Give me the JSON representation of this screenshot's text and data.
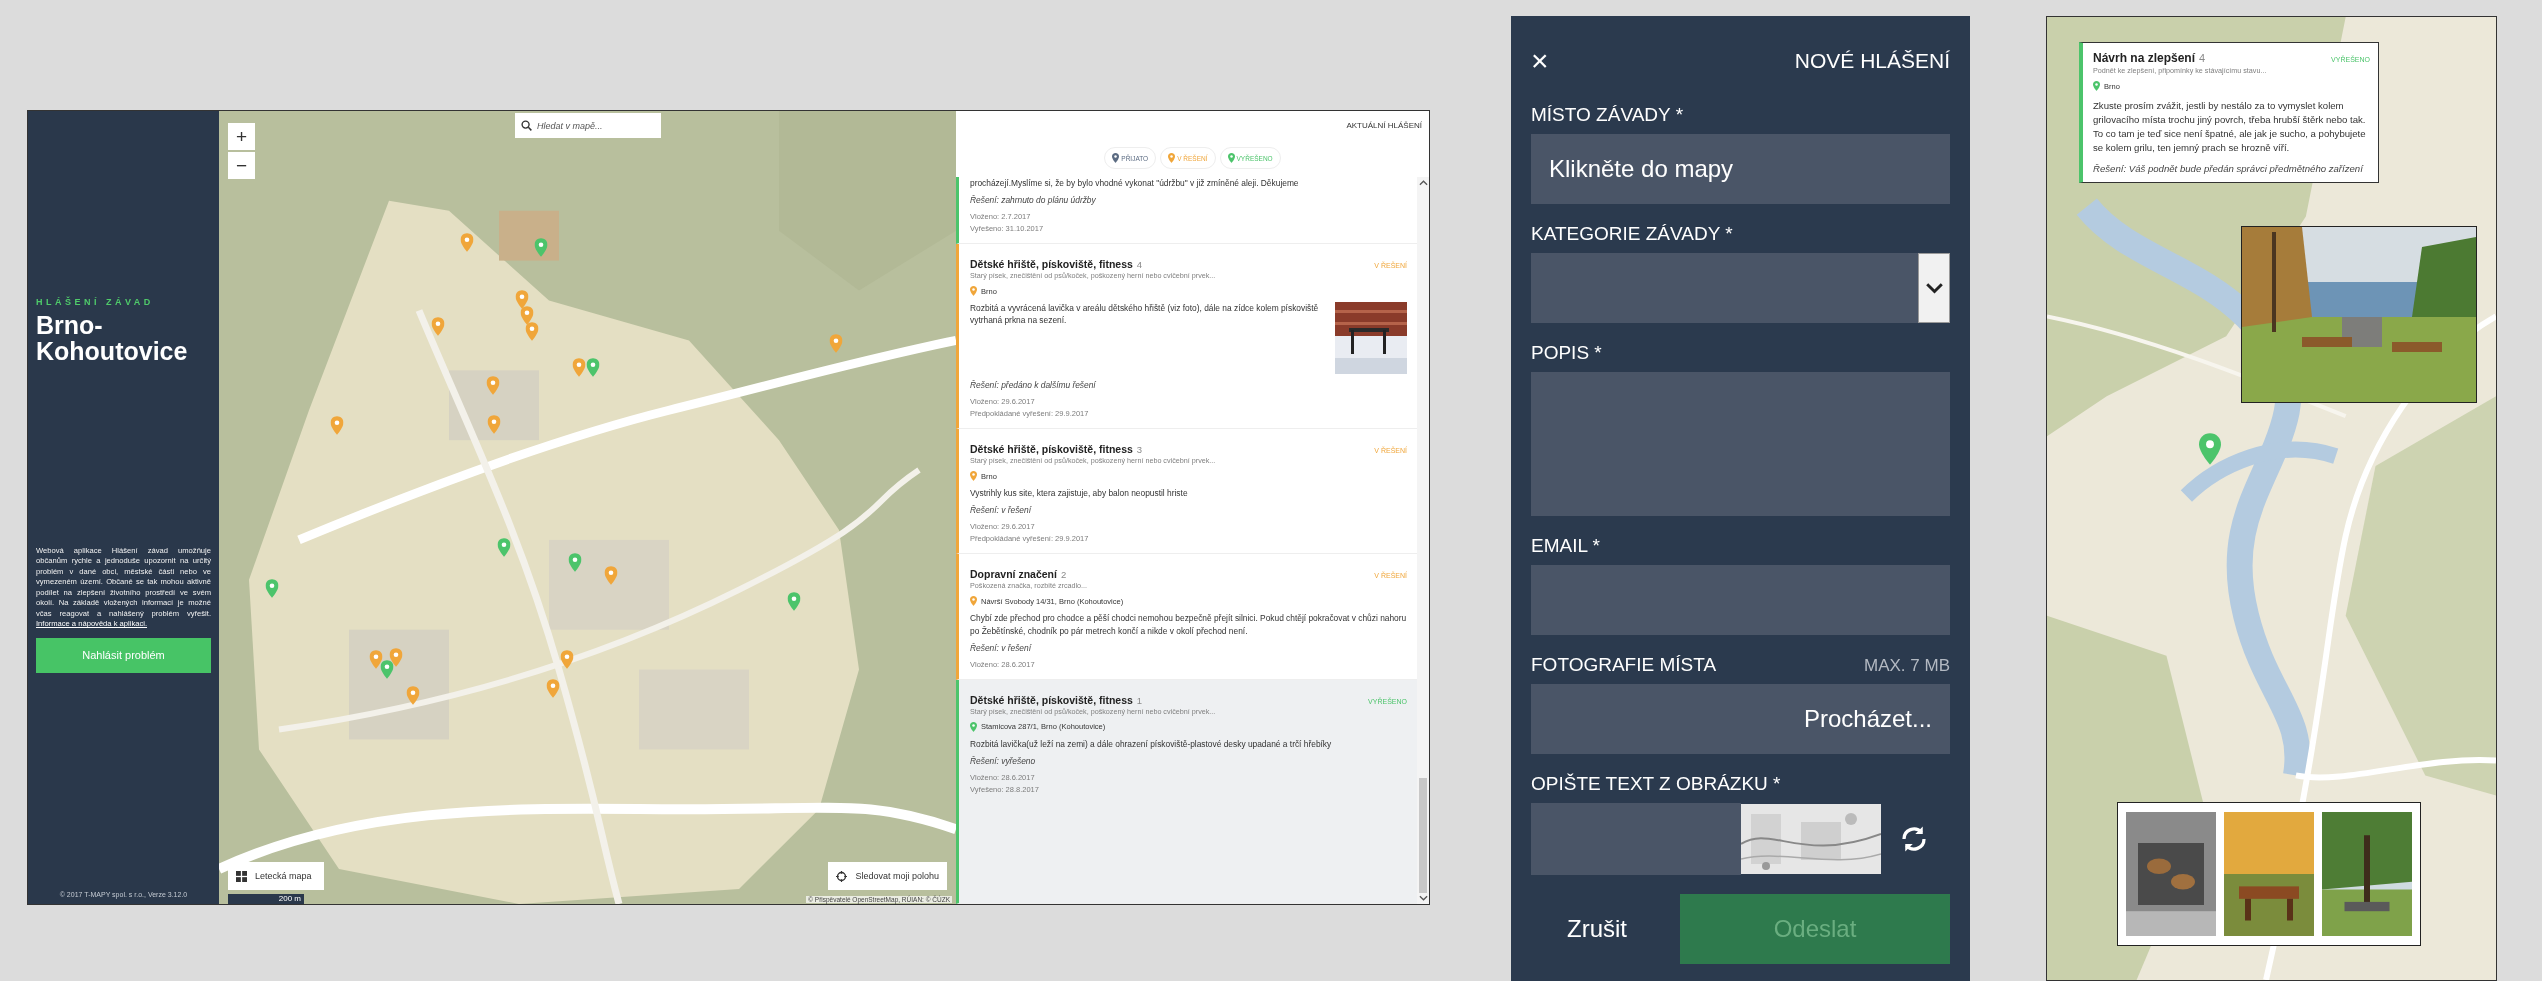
{
  "desktop": {
    "sidebar": {
      "kicker": "HLÁŠENÍ ZÁVAD",
      "title": "Brno-Kohoutovice",
      "about": "Webová aplikace Hlášení závad umožňuje občanům rychle a jednoduše upozornit na určitý problém v dané obci, městské části nebo ve vymezeném území. Občané se tak mohou aktivně podílet na zlepšení životního prostředí ve svém okolí. Na základě vložených informací je možné včas reagovat a nahlášený problém vyřešit.",
      "help_link": "Informace a nápověda k aplikaci.",
      "report_button": "Nahlásit problém",
      "footer": "© 2017 T-MAPY spol. s r.o., Verze 3.12.0"
    },
    "map": {
      "zoom_in": "+",
      "zoom_out": "−",
      "search": {
        "placeholder": "Hledat v mapě..."
      },
      "layer_button": "Letecká mapa",
      "scale": "200 m",
      "locate_button": "Sledovat moji polohu",
      "attribution": "© Přispěvatelé OpenStreetMap, RÚIAN: © ČÚZK",
      "markers": [
        {
          "color": "#f0a63a"
        },
        {
          "color": "#4cc46b"
        },
        {
          "color": "#f0a63a"
        },
        {
          "color": "#f0a63a"
        },
        {
          "color": "#f0a63a"
        },
        {
          "color": "#f0a63a"
        },
        {
          "color": "#f0a63a"
        },
        {
          "color": "#f0a63a"
        },
        {
          "color": "#4cc46b"
        },
        {
          "color": "#f0a63a"
        },
        {
          "color": "#f0a63a"
        },
        {
          "color": "#f0a63a"
        },
        {
          "color": "#f0a63a"
        },
        {
          "color": "#4cc46b"
        },
        {
          "color": "#4cc46b"
        },
        {
          "color": "#4cc46b"
        },
        {
          "color": "#4cc46b"
        },
        {
          "color": "#f0a63a"
        },
        {
          "color": "#f0a63a"
        },
        {
          "color": "#4cc46b"
        },
        {
          "color": "#f0a63a"
        },
        {
          "color": "#f0a63a"
        },
        {
          "color": "#f0a63a"
        }
      ]
    },
    "list": {
      "title": "AKTUÁLNÍ HLÁŠENÍ",
      "filters": [
        {
          "label": "PŘIJATO",
          "color": "#5b6b82"
        },
        {
          "label": "V ŘEŠENÍ",
          "color": "#f0a63a"
        },
        {
          "label": "VYŘEŠENO",
          "color": "#4cc46b"
        }
      ],
      "reports": [
        {
          "color": "#4cc46b",
          "selected": false,
          "description": "procházejí.Myslíme si, že by bylo vhodné vykonat \"údržbu\" v již zmíněné aleji. Děkujeme",
          "solution": "Řešení: zahrnuto do plánu údržby",
          "dates": [
            "Vloženo: 2.7.2017",
            "Vyřešeno: 31.10.2017"
          ]
        },
        {
          "color": "#f0a63a",
          "selected": false,
          "title": "Dětské hřiště, pískoviště, fitness",
          "count": "4",
          "status_label": "V ŘEŠENÍ",
          "subtitle": "Starý písek, znečištění od psů/koček, poškozený herní nebo cvičební prvek...",
          "location": "Brno",
          "description": "Rozbitá a vyvrácená lavička v areálu dětského hřiště (viz foto), dále na zídce kolem pískoviště vytrhaná prkna na sezení.",
          "photo": true,
          "solution": "Řešení: předáno k dalšímu řešení",
          "dates": [
            "Vloženo: 29.6.2017",
            "Předpokládané vyřešení: 29.9.2017"
          ]
        },
        {
          "color": "#f0a63a",
          "selected": false,
          "title": "Dětské hřiště, pískoviště, fitness",
          "count": "3",
          "status_label": "V ŘEŠENÍ",
          "subtitle": "Starý písek, znečištění od psů/koček, poškozený herní nebo cvičební prvek...",
          "location": "Brno",
          "description": "Vystrihly kus site, ktera zajistuje, aby balon neopustil hriste",
          "solution": "Řešení: v řešení",
          "dates": [
            "Vloženo: 29.6.2017",
            "Předpokládané vyřešení: 29.9.2017"
          ]
        },
        {
          "color": "#f0a63a",
          "selected": false,
          "title": "Dopravní značení",
          "count": "2",
          "status_label": "V ŘEŠENÍ",
          "subtitle": "Poškozená značka, rozbité zrcadlo...",
          "location": "Návrší Svobody 14/31, Brno (Kohoutovice)",
          "description": "Chybí zde přechod pro chodce a pěší chodci nemohou bezpečně přejít silnici. Pokud chtějí pokračovat v chůzi nahoru po Žebětínské, chodník po pár metrech končí a nikde v okolí přechod není.",
          "solution": "Řešení: v řešení",
          "dates": [
            "Vloženo: 28.6.2017"
          ]
        },
        {
          "color": "#4cc46b",
          "selected": true,
          "title": "Dětské hřiště, pískoviště, fitness",
          "count": "1",
          "status_label": "VYŘEŠENO",
          "subtitle": "Starý písek, znečištění od psů/koček, poškozený herní nebo cvičební prvek...",
          "location": "Stamicova 287/1, Brno (Kohoutovice)",
          "description": "Rozbitá lavička(už leží na zemi) a dále ohrazení pískoviště-plastové desky upadané a trčí hřebíky",
          "solution": "Řešení: vyřešeno",
          "dates": [
            "Vloženo: 28.6.2017",
            "Vyřešeno: 28.8.2017"
          ]
        }
      ]
    }
  },
  "form": {
    "close": "×",
    "title": "NOVÉ HLÁŠENÍ",
    "fields": [
      {
        "kind": "text",
        "label": "MÍSTO ZÁVADY *",
        "placeholder": "Klikněte do mapy"
      },
      {
        "kind": "select",
        "label": "KATEGORIE ZÁVADY *"
      },
      {
        "kind": "textarea",
        "label": "POPIS *"
      },
      {
        "kind": "text",
        "label": "EMAIL *"
      },
      {
        "kind": "file",
        "label": "FOTOGRAFIE MÍSTA",
        "hint": "MAX. 7 MB",
        "button": "Procházet..."
      },
      {
        "kind": "captcha",
        "label": "OPIŠTE TEXT Z OBRÁZKU *"
      }
    ],
    "cancel": "Zrušit",
    "submit": {
      "label": "Odeslat",
      "disabled": true
    }
  },
  "mobile": {
    "popup": {
      "color": "#4cc46b",
      "title": "Návrh na zlepšení",
      "count": "4",
      "status_label": "VYŘEŠENO",
      "subtitle": "Podnět ke zlepšení, připomínky ke stávajícímu stavu...",
      "location": "Brno",
      "description": "Zkuste prosím zvážit, jestli by nestálo za to vymyslet kolem grilovacího místa trochu jiný povrch, třeba hrubší štěrk nebo tak. To co tam je teď sice není špatné, ale jak je sucho, a pohybujete se kolem grilu, ten jemný prach se hrozně víří.",
      "solution": "Řešení: Váš podnět bude předán správci předmětného zařízení"
    },
    "marker": {
      "color": "#4cc46b"
    }
  }
}
